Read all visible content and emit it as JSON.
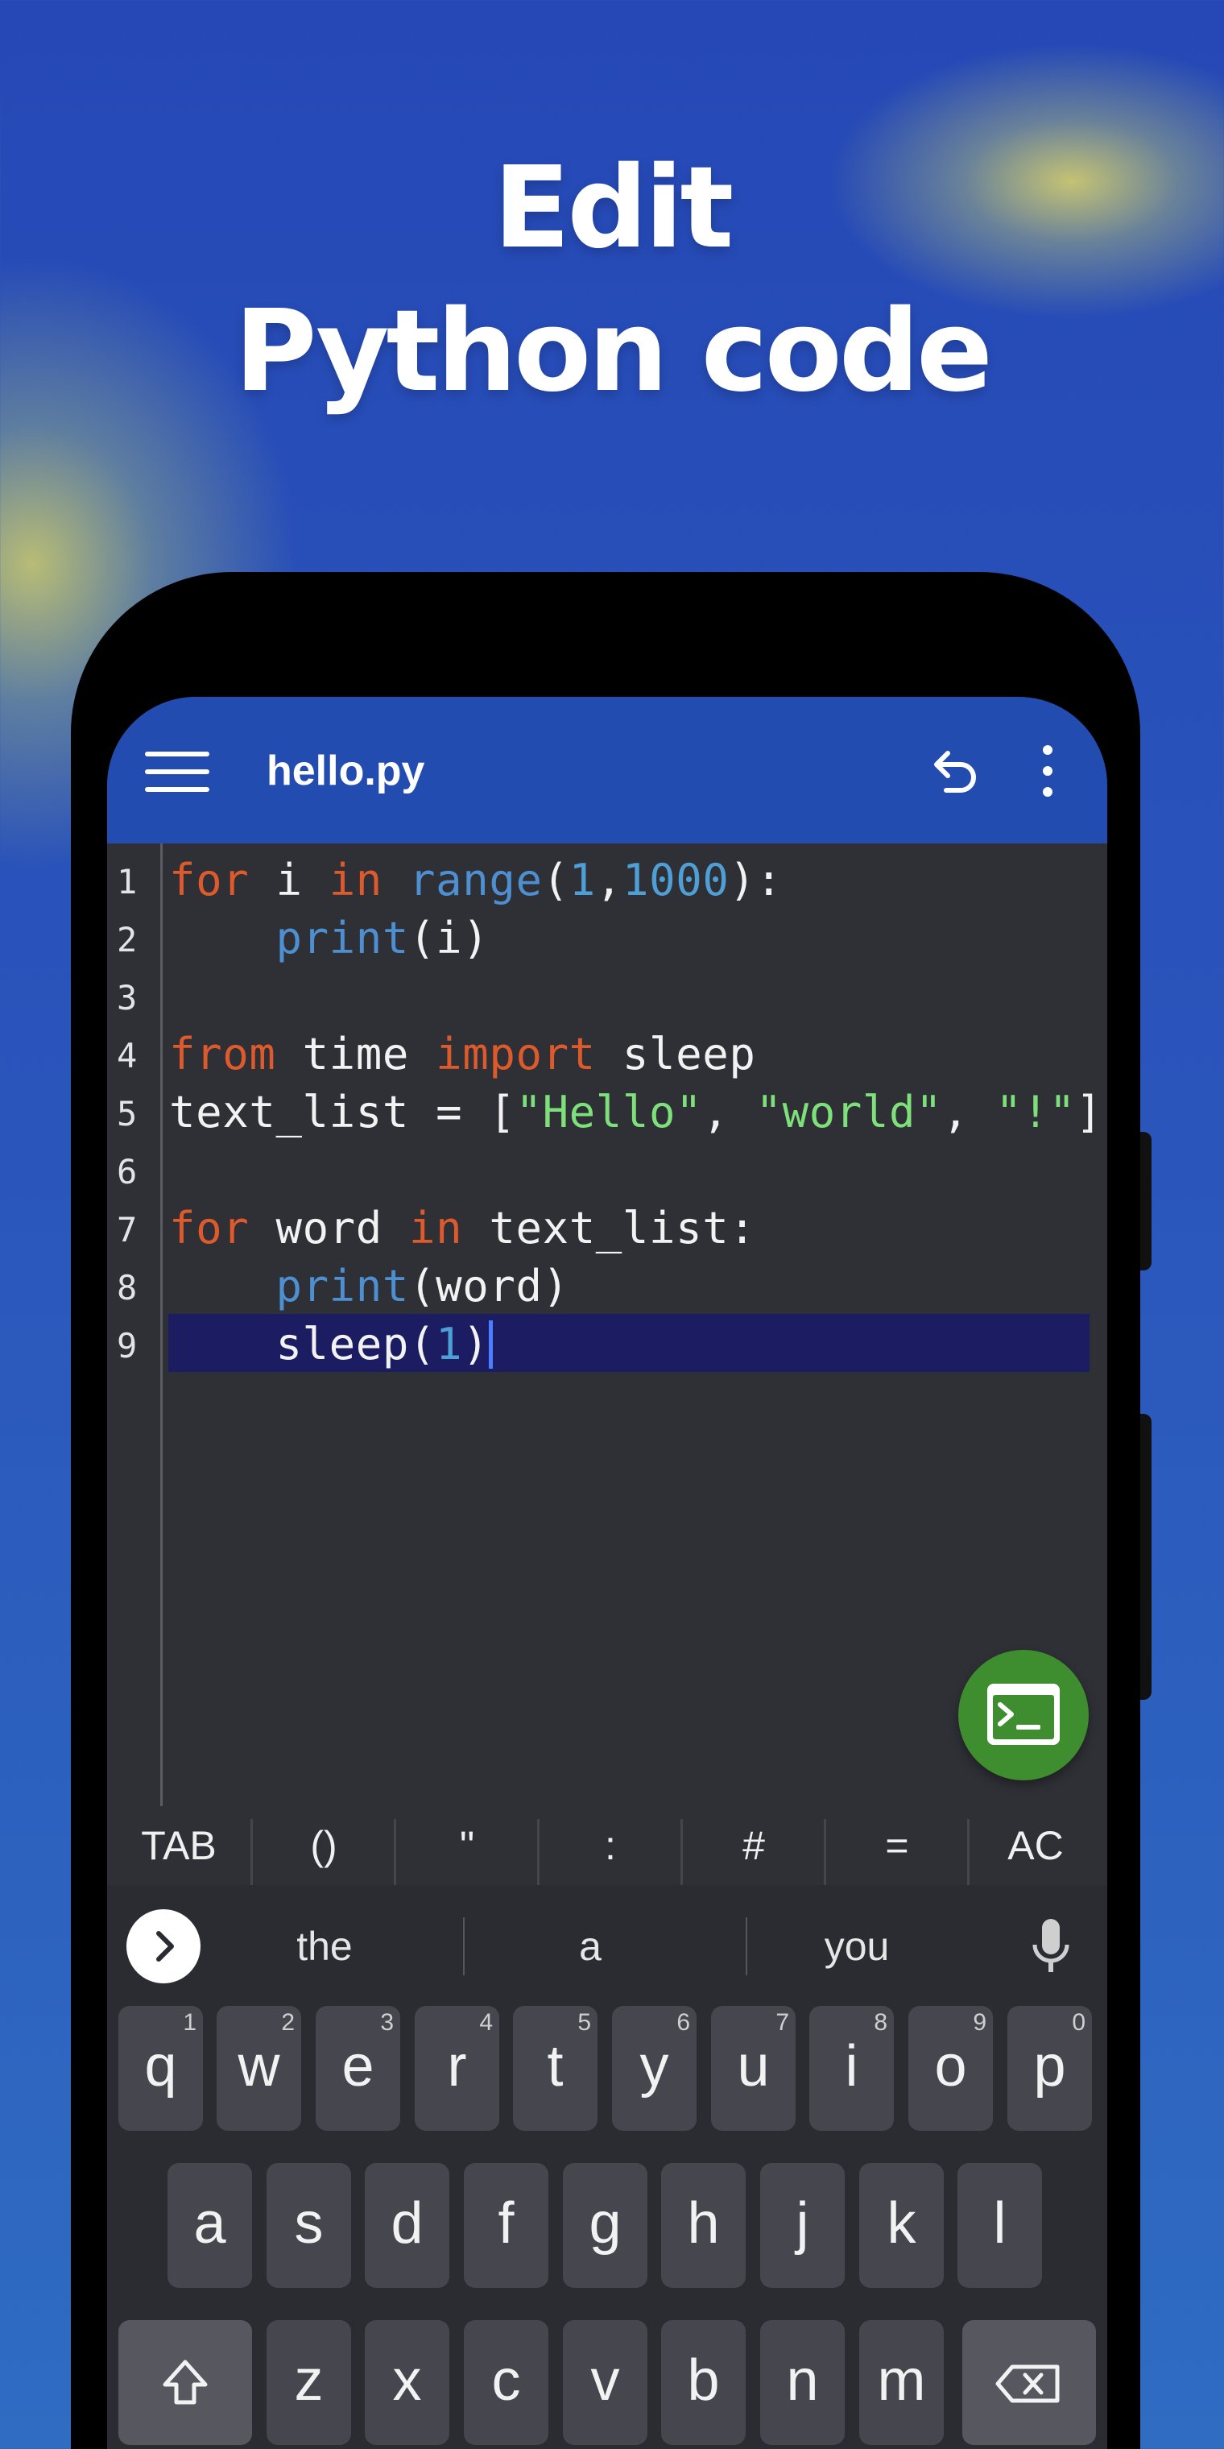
{
  "headline": {
    "line1": "Edit",
    "line2": "Python code"
  },
  "appbar": {
    "title": "hello.py",
    "menu_icon": "hamburger-menu-icon",
    "undo_icon": "undo-icon",
    "more_icon": "more-vert-icon"
  },
  "editor": {
    "line_numbers": [
      "1",
      "2",
      "3",
      "4",
      "5",
      "6",
      "7",
      "8",
      "9"
    ],
    "current_line": 9
  },
  "fab": {
    "icon": "terminal-icon"
  },
  "symbols": [
    "TAB",
    "()",
    "''",
    ":",
    "#",
    "=",
    "AC"
  ],
  "keyboard": {
    "suggestions": [
      "the",
      "a",
      "you"
    ],
    "row1": [
      {
        "key": "q",
        "hint": "1"
      },
      {
        "key": "w",
        "hint": "2"
      },
      {
        "key": "e",
        "hint": "3"
      },
      {
        "key": "r",
        "hint": "4"
      },
      {
        "key": "t",
        "hint": "5"
      },
      {
        "key": "y",
        "hint": "6"
      },
      {
        "key": "u",
        "hint": "7"
      },
      {
        "key": "i",
        "hint": "8"
      },
      {
        "key": "o",
        "hint": "9"
      },
      {
        "key": "p",
        "hint": "0"
      }
    ],
    "row2": [
      "a",
      "s",
      "d",
      "f",
      "g",
      "h",
      "j",
      "k",
      "l"
    ],
    "row3": [
      "z",
      "x",
      "c",
      "v",
      "b",
      "n",
      "m"
    ],
    "colors": {
      "key_bg": "#46474e",
      "keyboard_bg": "#2b2c31",
      "accent": "#234cb1",
      "fab": "#3e8e2f"
    }
  }
}
